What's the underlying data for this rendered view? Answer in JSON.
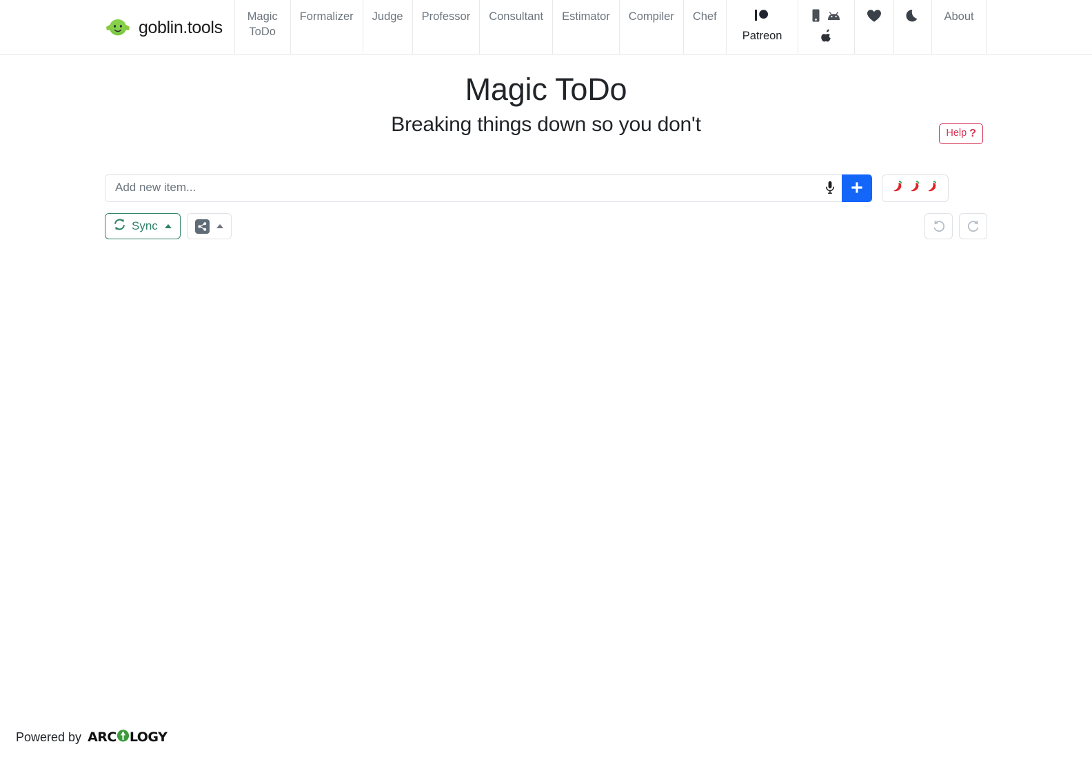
{
  "brand": {
    "name": "goblin.tools",
    "logo_icon": "goblin-face-icon",
    "logo_color": "#7cbf36"
  },
  "nav": {
    "items": [
      {
        "label": "Magic ToDo",
        "lines": [
          "Magic",
          "ToDo"
        ],
        "active": true
      },
      {
        "label": "Formalizer"
      },
      {
        "label": "Judge"
      },
      {
        "label": "Professor"
      },
      {
        "label": "Consultant"
      },
      {
        "label": "Estimator"
      },
      {
        "label": "Compiler"
      },
      {
        "label": "Chef"
      }
    ],
    "patreon": {
      "label": "Patreon",
      "icon": "patreon-icon"
    },
    "platforms": {
      "icons": [
        "mobile-phone-icon",
        "android-icon",
        "apple-icon"
      ]
    },
    "favorites": {
      "icon": "heart-icon"
    },
    "theme_toggle": {
      "icon": "moon-icon"
    },
    "about": {
      "label": "About"
    }
  },
  "header": {
    "title": "Magic ToDo",
    "subtitle": "Breaking things down so you don't",
    "help_label": "Help",
    "help_symbol": "?",
    "help_color": "#d63354"
  },
  "composer": {
    "placeholder": "Add new item...",
    "value": "",
    "mic_icon": "microphone-icon",
    "add_label": "+",
    "add_color": "#1366f8",
    "spiciness": {
      "icon": "chili-pepper-icon",
      "level": 3,
      "peppers": [
        "🌶",
        "🌶",
        "🌶"
      ]
    }
  },
  "toolbar": {
    "sync_label": "Sync",
    "sync_icon": "refresh-sync-icon",
    "sync_color": "#2f8169",
    "sync_caret": "caret-up-icon",
    "share_icon": "share-nodes-icon",
    "share_caret": "caret-up-icon",
    "undo_icon": "undo-arrow-icon",
    "redo_icon": "redo-arrow-icon",
    "undo_enabled": false,
    "redo_enabled": false
  },
  "list": {
    "items": [],
    "empty": true
  },
  "footer": {
    "powered_by": "Powered by",
    "brand_part1": "ARC",
    "brand_part2": "LOGY",
    "brand_mark_icon": "arcology-globe-icon",
    "brand_mark_color": "#3c9a3c"
  }
}
